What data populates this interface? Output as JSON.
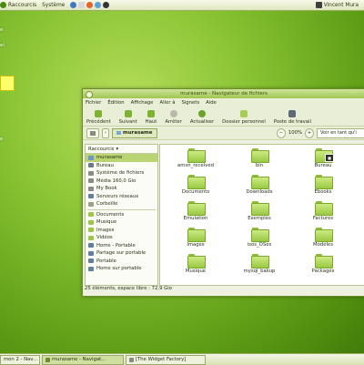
{
  "top_panel": {
    "menus": [
      "Raccourcis",
      "Système"
    ],
    "user": "Vincent Mura"
  },
  "desktop": {
    "labels": [
      "e",
      "el",
      "e"
    ]
  },
  "window": {
    "title": "murasame - Navigateur de fichiers",
    "menus": [
      "Fichier",
      "Édition",
      "Affichage",
      "Aller à",
      "Signets",
      "Aide"
    ],
    "toolbar": {
      "back": "Précédent",
      "forward": "Suivant",
      "up": "Haut",
      "stop": "Arrêter",
      "reload": "Actualiser",
      "home": "Dossier personnel",
      "computer": "Poste de travail"
    },
    "location": {
      "crumb": "murasame",
      "zoom": "100%",
      "view": "Voir en tant qu'i"
    },
    "sidebar": {
      "header": "Raccourcis",
      "places": [
        "murasame",
        "Bureau",
        "Système de fichiers",
        "Média 160,0 Gio",
        "My Book",
        "Serveurs réseaux",
        "Corbeille"
      ],
      "bookmarks": [
        "Documents",
        "Musique",
        "Images",
        "Vidéos",
        "Home - Portable",
        "Partage sur portable",
        "Portable",
        "Home sur portable"
      ]
    },
    "files": [
      "amsn_received",
      "bin",
      "Bureau",
      "Documents",
      "Downloads",
      "Ebooks",
      "Emulation",
      "Exemples",
      "Factures",
      "Images",
      "isos_OSes",
      "Modèles",
      "Musique",
      "mysql_bakup",
      "Packages"
    ],
    "status": "25 éléments, espace libre : 72,9 Gio"
  },
  "taskbar": [
    "mon 2 - Nav...",
    "murasame - Navigat...",
    "[The Widget Factory]"
  ]
}
